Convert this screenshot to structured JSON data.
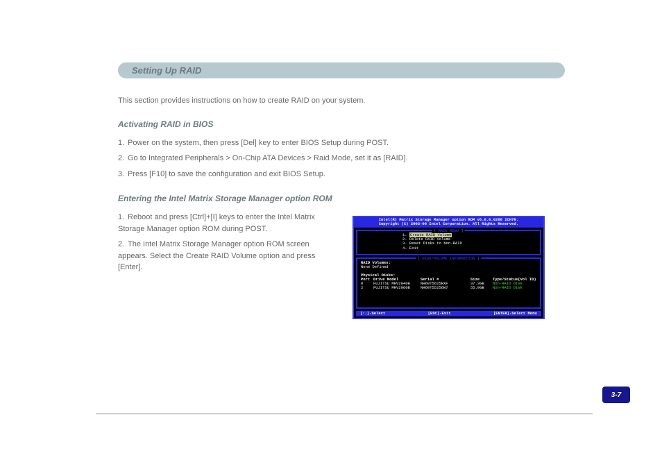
{
  "section_header": "Setting Up RAID",
  "intro": "This section provides instructions on how to create RAID on your system.",
  "subsection_title": "Activating RAID in BIOS",
  "steps": [
    "Power on the system, then press [Del] key to enter BIOS Setup during POST.",
    "Go to Integrated Peripherals > On-Chip ATA Devices > Raid Mode, set it as [RAID].",
    "Press [F10] to save the configuration and exit BIOS Setup."
  ],
  "subsection2_title": "Entering the Intel Matrix Storage Manager option ROM",
  "steps2": [
    "Reboot and press [Ctrl]+[I] keys to enter the Intel Matrix Storage Manager option ROM during POST.",
    "The Intel Matrix Storage Manager option ROM screen appears. Select the Create RAID Volume option and press [Enter]."
  ],
  "bios": {
    "header_line1": "Intel(R) Matrix Storage Manager option ROM v6.0.0.0268 ICH7R.",
    "header_line2": "Copyright (C) 2003-06 Intel Corporation. All Rights Reserved.",
    "main_menu_title": "MAIN MENU",
    "menu_items": [
      {
        "num": "1.",
        "label": "Create RAID Volume",
        "selected": true
      },
      {
        "num": "2.",
        "label": "Delete RAID Volume",
        "selected": false
      },
      {
        "num": "3.",
        "label": "Reset Disks to Non-RAID",
        "selected": false
      },
      {
        "num": "4.",
        "label": "Exit",
        "selected": false
      }
    ],
    "disk_info_title": "DISK/VOLUME INFORMATION",
    "raid_volumes_label": "RAID Volumes:",
    "raid_volumes_value": "None Defined",
    "phys_disks_label": "Physical Disks:",
    "table_header": {
      "port": "Port",
      "model": "Drive Model",
      "serial": "Serial #",
      "size": "Size",
      "status": "Type/Status(Vol ID)"
    },
    "disks": [
      {
        "port": "0",
        "model": "FUJITSU MHV2040B",
        "serial": "NH60T5625RXF",
        "size": "37.3GB",
        "status": "Non-RAID Disk"
      },
      {
        "port": "2",
        "model": "FUJITSU MHV2060B",
        "serial": "NH60T55256W7",
        "size": "55.9GB",
        "status": "Non-RAID Disk"
      }
    ],
    "footer_left": "[↑↓]-Select",
    "footer_mid": "[ESC]-Exit",
    "footer_right": "[ENTER]-Select Menu"
  },
  "page_number": "3-7"
}
